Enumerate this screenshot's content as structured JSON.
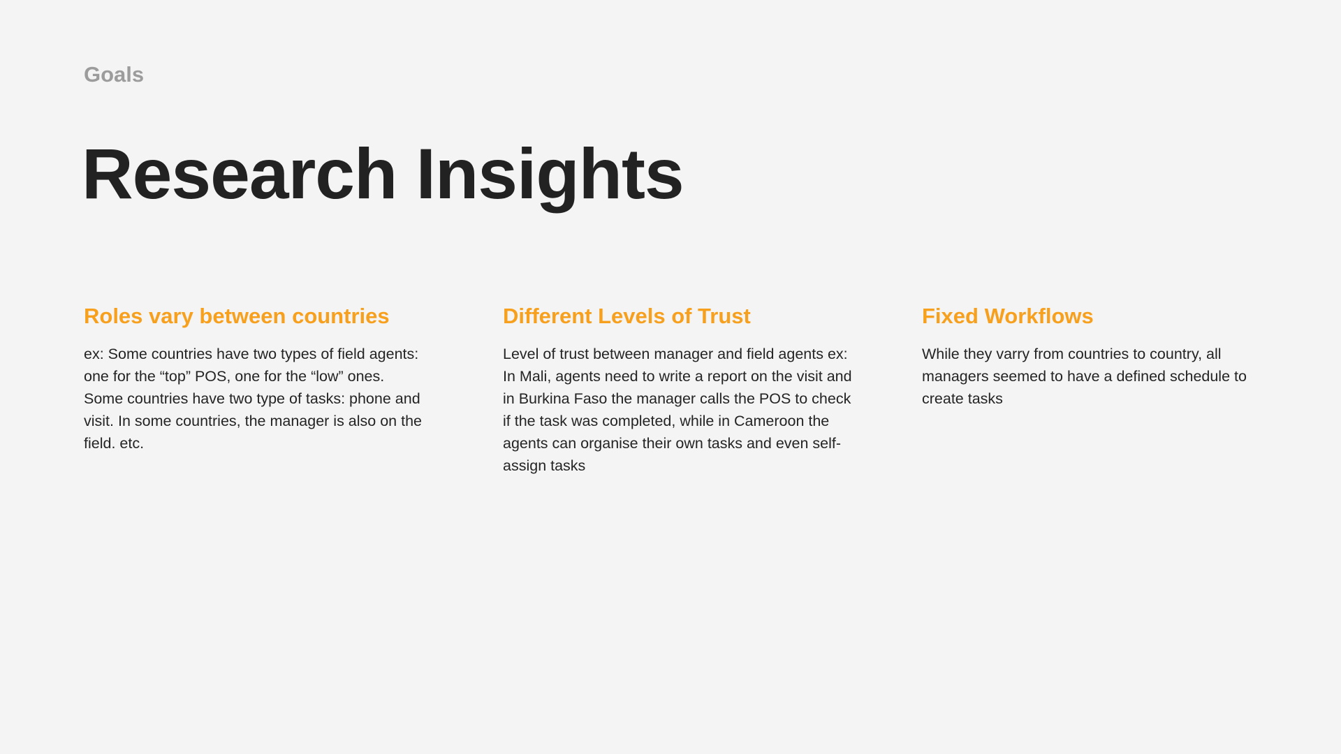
{
  "header": {
    "eyebrow": "Goals",
    "title": "Research Insights"
  },
  "insights": [
    {
      "heading": "Roles vary between countries",
      "body": "ex: Some countries have two types of field agents: one for the “top” POS, one for the “low” ones. Some countries have two type of tasks: phone and visit. In some countries, the manager is also on the field. etc."
    },
    {
      "heading": "Different Levels of Trust",
      "body": "Level of trust between manager and field agents ex: In Mali, agents need to write a report on the visit and in Burkina Faso the manager calls the POS to check if the task was completed, while in Cameroon the agents can organise their own tasks and even self-assign tasks"
    },
    {
      "heading": "Fixed Workflows",
      "body": "While they varry from countries to country, all managers seemed to have a defined schedule to create tasks"
    }
  ],
  "colors": {
    "background": "#f4f4f4",
    "accent": "#f7a01e",
    "title": "#222222",
    "eyebrow": "#9c9c9c",
    "body": "#242424"
  }
}
